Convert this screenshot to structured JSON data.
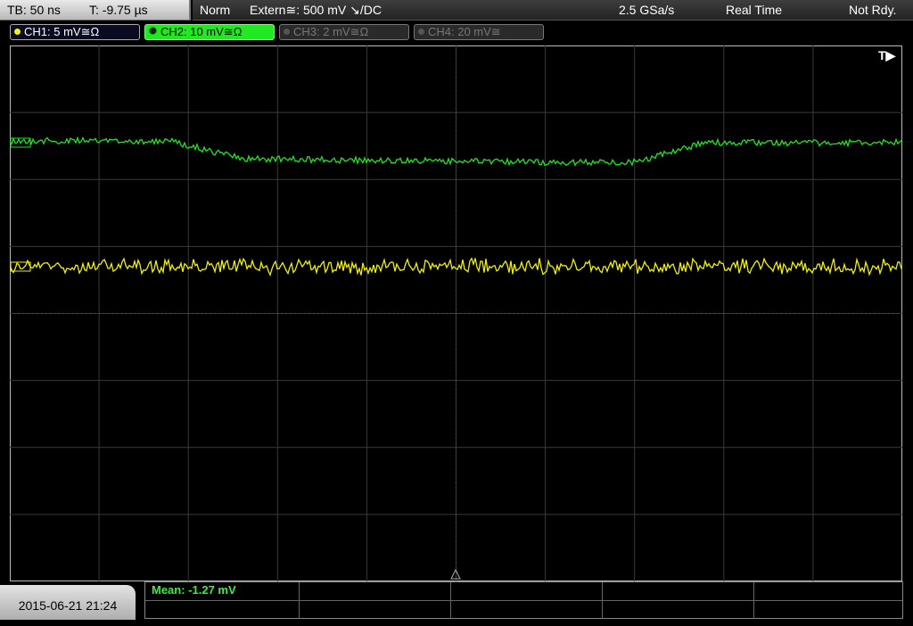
{
  "timebase": {
    "tb": "TB: 50 ns",
    "t": "T: -9.75 µs"
  },
  "status": {
    "mode": "Norm",
    "trigger": "Extern≅: 500 mV ↘/DC",
    "rate": "2.5 GSa/s",
    "acq": "Real Time",
    "ready": "Not Rdy."
  },
  "channels": [
    {
      "label": "CH1: 5 mV≅Ω",
      "color": "#f0f020",
      "active": true
    },
    {
      "label": "CH2: 10 mV≅Ω",
      "color": "#22e822",
      "active": true
    },
    {
      "label": "CH3: 2 mV≅Ω",
      "color": "#777777",
      "active": false
    },
    {
      "label": "CH4: 20 mV≅",
      "color": "#777777",
      "active": false
    }
  ],
  "trigger_marker": "T▶",
  "colors": {
    "ch1_trace": "#f2f200",
    "ch2_trace": "#1ee61e",
    "grid": "#3a3a3a"
  },
  "datetime": "2015-06-21 21:24",
  "measurement": "Mean: -1.27 mV"
}
